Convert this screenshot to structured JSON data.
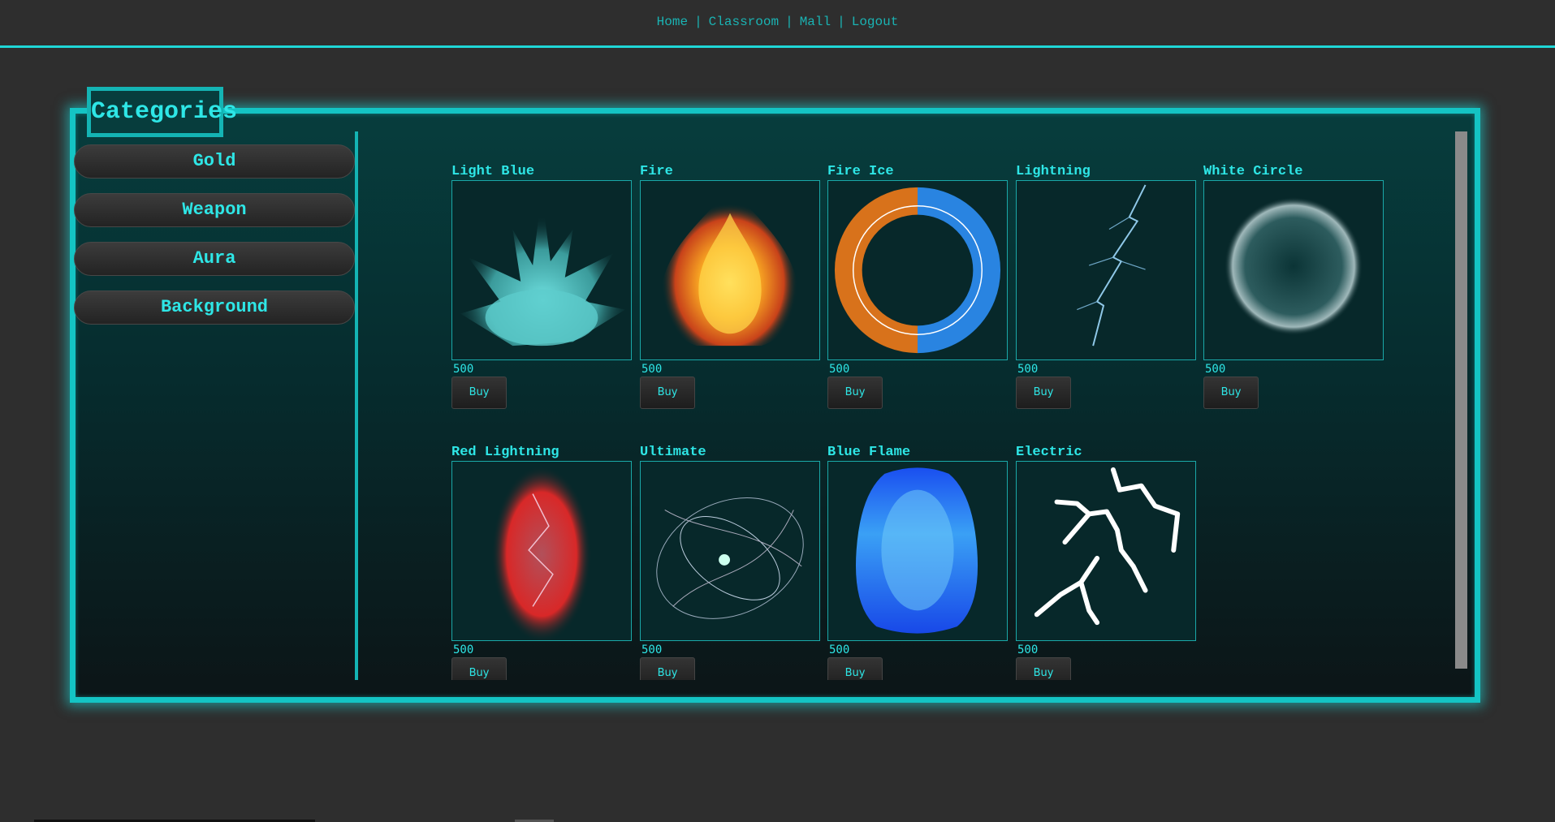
{
  "nav": {
    "links": [
      "Home",
      "Classroom",
      "Mall",
      "Logout"
    ],
    "separator": "|"
  },
  "categories": {
    "title": "Categories",
    "items": [
      "Gold",
      "Weapon",
      "Aura",
      "Background"
    ]
  },
  "products": [
    {
      "name": "Light Blue",
      "price": "500",
      "buy": "Buy",
      "icon": "light-blue-aura-image"
    },
    {
      "name": "Fire",
      "price": "500",
      "buy": "Buy",
      "icon": "fire-aura-image"
    },
    {
      "name": "Fire Ice",
      "price": "500",
      "buy": "Buy",
      "icon": "fire-ice-aura-image"
    },
    {
      "name": "Lightning",
      "price": "500",
      "buy": "Buy",
      "icon": "lightning-aura-image"
    },
    {
      "name": "White Circle",
      "price": "500",
      "buy": "Buy",
      "icon": "white-circle-aura-image"
    },
    {
      "name": "Red Lightning",
      "price": "500",
      "buy": "Buy",
      "icon": "red-lightning-aura-image"
    },
    {
      "name": "Ultimate",
      "price": "500",
      "buy": "Buy",
      "icon": "ultimate-aura-image"
    },
    {
      "name": "Blue Flame",
      "price": "500",
      "buy": "Buy",
      "icon": "blue-flame-aura-image"
    },
    {
      "name": "Electric",
      "price": "500",
      "buy": "Buy",
      "icon": "electric-aura-image"
    }
  ],
  "colors": {
    "accent": "#14c4c4",
    "text": "#2ee6e6",
    "background": "#2e2e2e"
  }
}
